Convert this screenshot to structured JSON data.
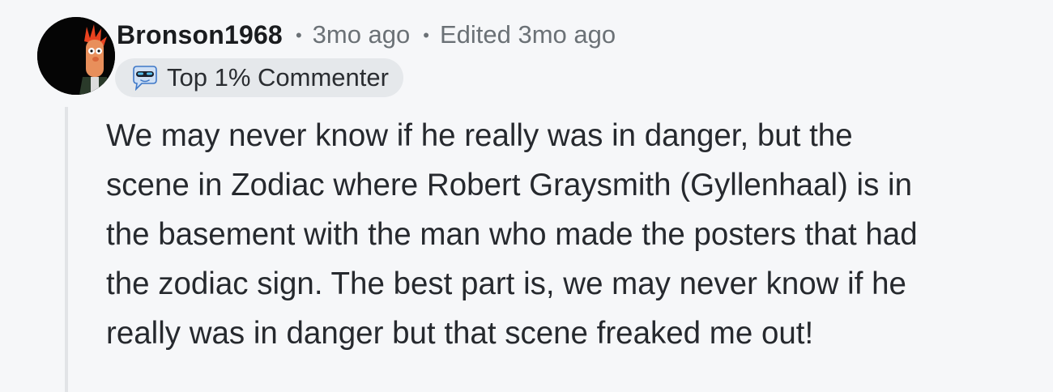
{
  "comment": {
    "author": "Bronson1968",
    "separator": "•",
    "timestamp": "3mo ago",
    "edited": "Edited 3mo ago",
    "badge": {
      "label": "Top 1% Commenter",
      "icon": "top-commenter-icon"
    },
    "avatar_icon": "beaker-muppet-avatar",
    "body_lines": [
      "We may never know if he really was in danger, but the",
      "scene in Zodiac where Robert Graysmith (Gyllenhaal) is in",
      "the basement with the man who made the posters that had",
      "the zodiac sign. The best part is, we may never know if he",
      "really was in danger but that scene freaked me out!"
    ]
  },
  "colors": {
    "background": "#f6f7f9",
    "badge_bg": "#e5e8eb",
    "muted_text": "#6b7176",
    "thread_line": "#e2e4e7"
  }
}
